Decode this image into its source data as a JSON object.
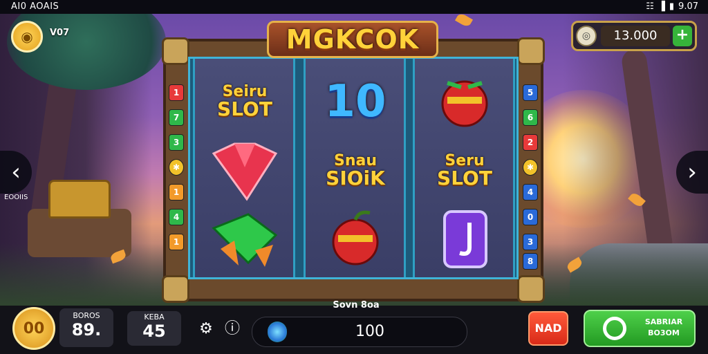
{
  "status_bar": {
    "left": "AI0 AOAIS",
    "time": "9.07",
    "icons": [
      "wifi-icon",
      "signal-icon",
      "battery-icon"
    ]
  },
  "header": {
    "level": "V07",
    "balance": "13.000",
    "plus": "+"
  },
  "title": "MGKCOK",
  "side_label": "EOOIIS",
  "reels": [
    [
      {
        "type": "text",
        "l1": "Seiru",
        "l2": "SLOT"
      },
      {
        "type": "icon",
        "name": "red-gem-icon"
      },
      {
        "type": "icon",
        "name": "green-gem-icon"
      }
    ],
    [
      {
        "type": "number",
        "value": "10"
      },
      {
        "type": "text",
        "l1": "Snau",
        "l2": "SIOiK"
      },
      {
        "type": "icon",
        "name": "cherry-bomb-icon"
      }
    ],
    [
      {
        "type": "icon",
        "name": "cherry-bomb-icon"
      },
      {
        "type": "text",
        "l1": "Seru",
        "l2": "SLOT"
      },
      {
        "type": "icon",
        "name": "purple-gem-icon"
      }
    ]
  ],
  "paylines_left": [
    "1",
    "7",
    "3",
    "",
    "1",
    "4",
    "1"
  ],
  "paylines_right": [
    "5",
    "6",
    "2",
    "",
    "4",
    "0",
    "3",
    "8"
  ],
  "footer": {
    "bonus_label": "BOROS",
    "bonus_value": "89.",
    "bet_label": "KEBA",
    "bet_value": "45",
    "spin_caption": "Sovn 8oa",
    "total_bet": "100",
    "max_label": "NAD",
    "spin_label": "SABRIAR BO3OM",
    "coin_face": "00"
  },
  "colors": {
    "accent_gold": "#ffd23a",
    "spin_green": "#36b43a",
    "max_red": "#e83a22",
    "reel_blue": "#3fb4d8"
  }
}
